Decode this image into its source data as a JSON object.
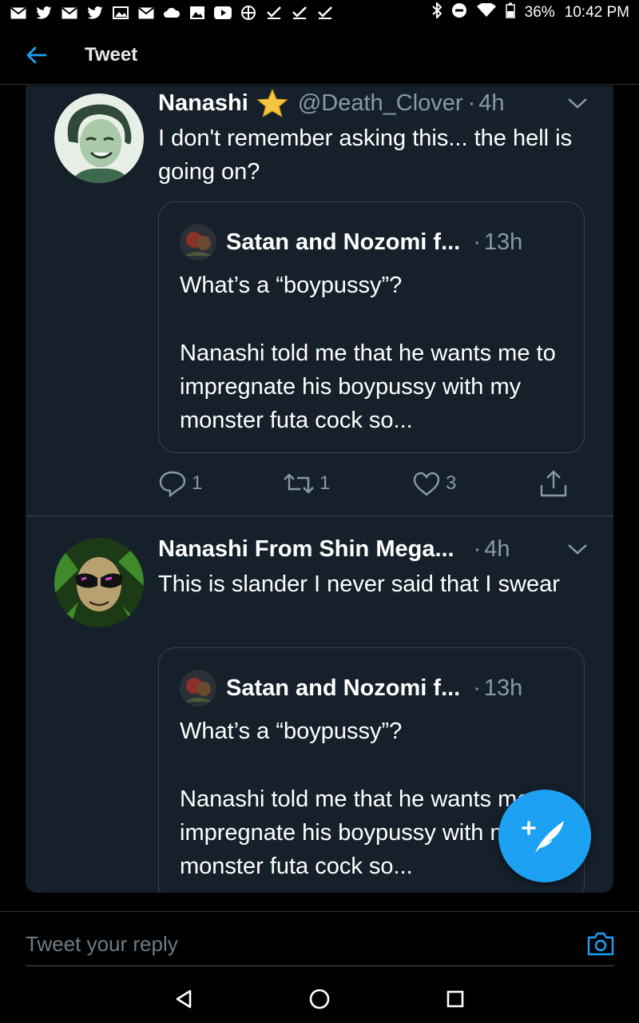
{
  "status_bar": {
    "notification_icons": [
      "gmail-icon",
      "twitter-icon",
      "gmail-icon",
      "twitter-icon",
      "gallery-icon",
      "gmail-icon",
      "cloud-icon",
      "image-icon",
      "youtube-icon",
      "app-icon",
      "check-icon",
      "check-icon",
      "check-icon"
    ],
    "battery": "36%",
    "time": "10:42 PM"
  },
  "app_bar": {
    "title": "Tweet"
  },
  "tweets": [
    {
      "display_name": "Nanashi",
      "handle": "@Death_Clover",
      "dot": "·",
      "time": "4h",
      "text": "I don't remember asking this... the hell is going on?",
      "quote": {
        "name": "Satan and Nozomi f...",
        "dot": "·",
        "time": "13h",
        "line1": "What’s a “boypussy”?",
        "body": "Nanashi told me that he wants me to impregnate his boypussy with my monster futa cock so..."
      },
      "actions": {
        "replies": "1",
        "retweets": "1",
        "likes": "3"
      }
    },
    {
      "display_name": "Nanashi From Shin Mega...",
      "dot": "·",
      "time": "4h",
      "text": "This is slander I never said that I swear",
      "quote": {
        "name": "Satan and Nozomi f...",
        "dot": "·",
        "time": "13h",
        "line1": "What’s a “boypussy”?",
        "body": "Nanashi told me that he wants me to impregnate his boypussy with my monster futa cock so..."
      }
    }
  ],
  "reply": {
    "placeholder": "Tweet your reply"
  },
  "colors": {
    "accent": "#1da1f2",
    "card_bg": "#15202b",
    "muted": "#8899a6",
    "border": "#38444d"
  }
}
